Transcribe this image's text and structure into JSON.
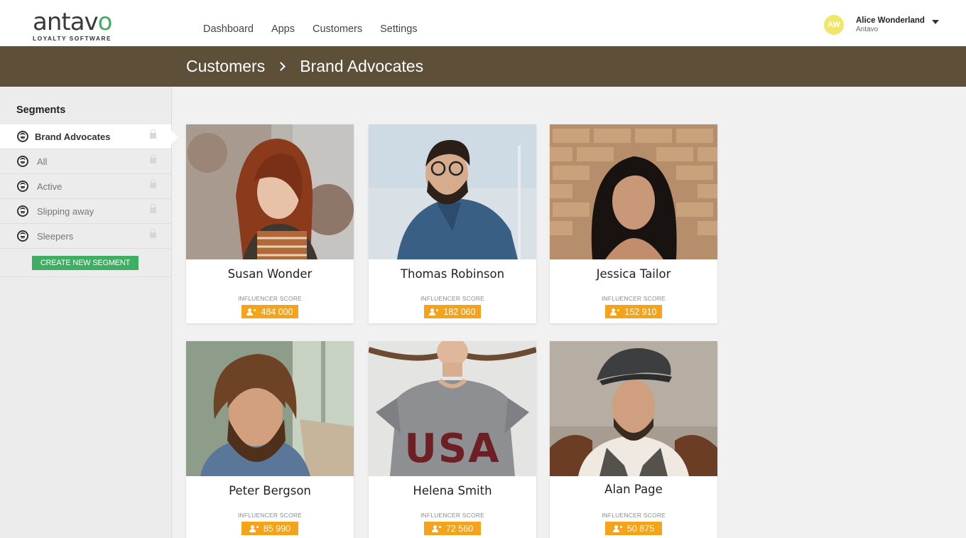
{
  "header": {
    "logo_word_pre": "antav",
    "logo_word_o": "o",
    "logo_sub": "LOYALTY SOFTWARE",
    "nav": [
      "Dashboard",
      "Apps",
      "Customers",
      "Settings"
    ],
    "user": {
      "initials": "AW",
      "name": "Alice Wonderland",
      "org": "Antavo"
    }
  },
  "breadcrumb": {
    "parent": "Customers",
    "current": "Brand Advocates"
  },
  "sidebar": {
    "title": "Segments",
    "segments": [
      "Brand Advocates",
      "All",
      "Active",
      "Slipping away",
      "Sleepers"
    ],
    "create_label": "CREATE NEW SEGMENT"
  },
  "score_label": "INFLUENCER SCORE",
  "cards": [
    {
      "name": "Susan Wonder",
      "score": "484 000"
    },
    {
      "name": "Thomas Robinson",
      "score": "182 060"
    },
    {
      "name": "Jessica Tailor",
      "score": "152 910"
    },
    {
      "name": "Peter Bergson",
      "score": "85 990"
    },
    {
      "name": "Helena Smith",
      "score": "72 560"
    },
    {
      "name": "Alan Page",
      "score": "50 875"
    }
  ],
  "photo_text": "USA",
  "colors": {
    "header_bar": "#5e4f39",
    "accent_green": "#3fae63",
    "score_orange": "#f4a31a",
    "avatar_yellow": "#f0e76a"
  }
}
